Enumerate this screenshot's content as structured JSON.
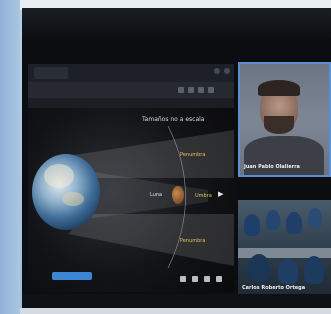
{
  "browser": {
    "tab_label": "",
    "bookmarks": [
      "",
      "",
      "",
      ""
    ]
  },
  "slide": {
    "title": "Tamaños no a escala",
    "luna_label": "Luna",
    "penumbra_top": "Penumbra",
    "penumbra_bottom": "Penumbra",
    "umbra_label": "Umbra",
    "button_label": ""
  },
  "participants": [
    {
      "name": "Juan Pablo Olalierra"
    },
    {
      "name": "Carlos Roberto Ortega"
    }
  ],
  "colors": {
    "accent_border": "#5b8fd2",
    "label_yellow": "#e6c35a",
    "slide_button": "#3d86d6"
  },
  "icons": [
    "arrow-right-icon",
    "browser-tab-icon",
    "window-control-icon",
    "media-control-icon"
  ]
}
